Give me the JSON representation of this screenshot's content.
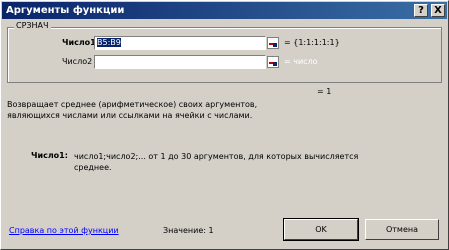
{
  "window": {
    "title": "Аргументы функции",
    "help_button": "?",
    "close_button": "X"
  },
  "group": {
    "legend": "СРЗНАЧ"
  },
  "args": [
    {
      "label": "Число1",
      "value": "B5:B9",
      "result": "= {1:1:1:1:1}"
    },
    {
      "label": "Число2",
      "value": "",
      "result": "= число"
    }
  ],
  "formula_result": "= 1",
  "description": {
    "line1": "Возвращает среднее (арифметическое) своих аргументов,",
    "line2": "являющихся числами или ссылками на ячейки с числами."
  },
  "argument_help": {
    "name": "Число1:",
    "line1": "число1;число2;... от 1 до 30 аргументов, для которых вычисляется",
    "line2": "среднее."
  },
  "footer": {
    "help_link": "Справка по этой функции",
    "value_label": "Значение: 1",
    "ok": "OK",
    "cancel": "Отмена"
  }
}
